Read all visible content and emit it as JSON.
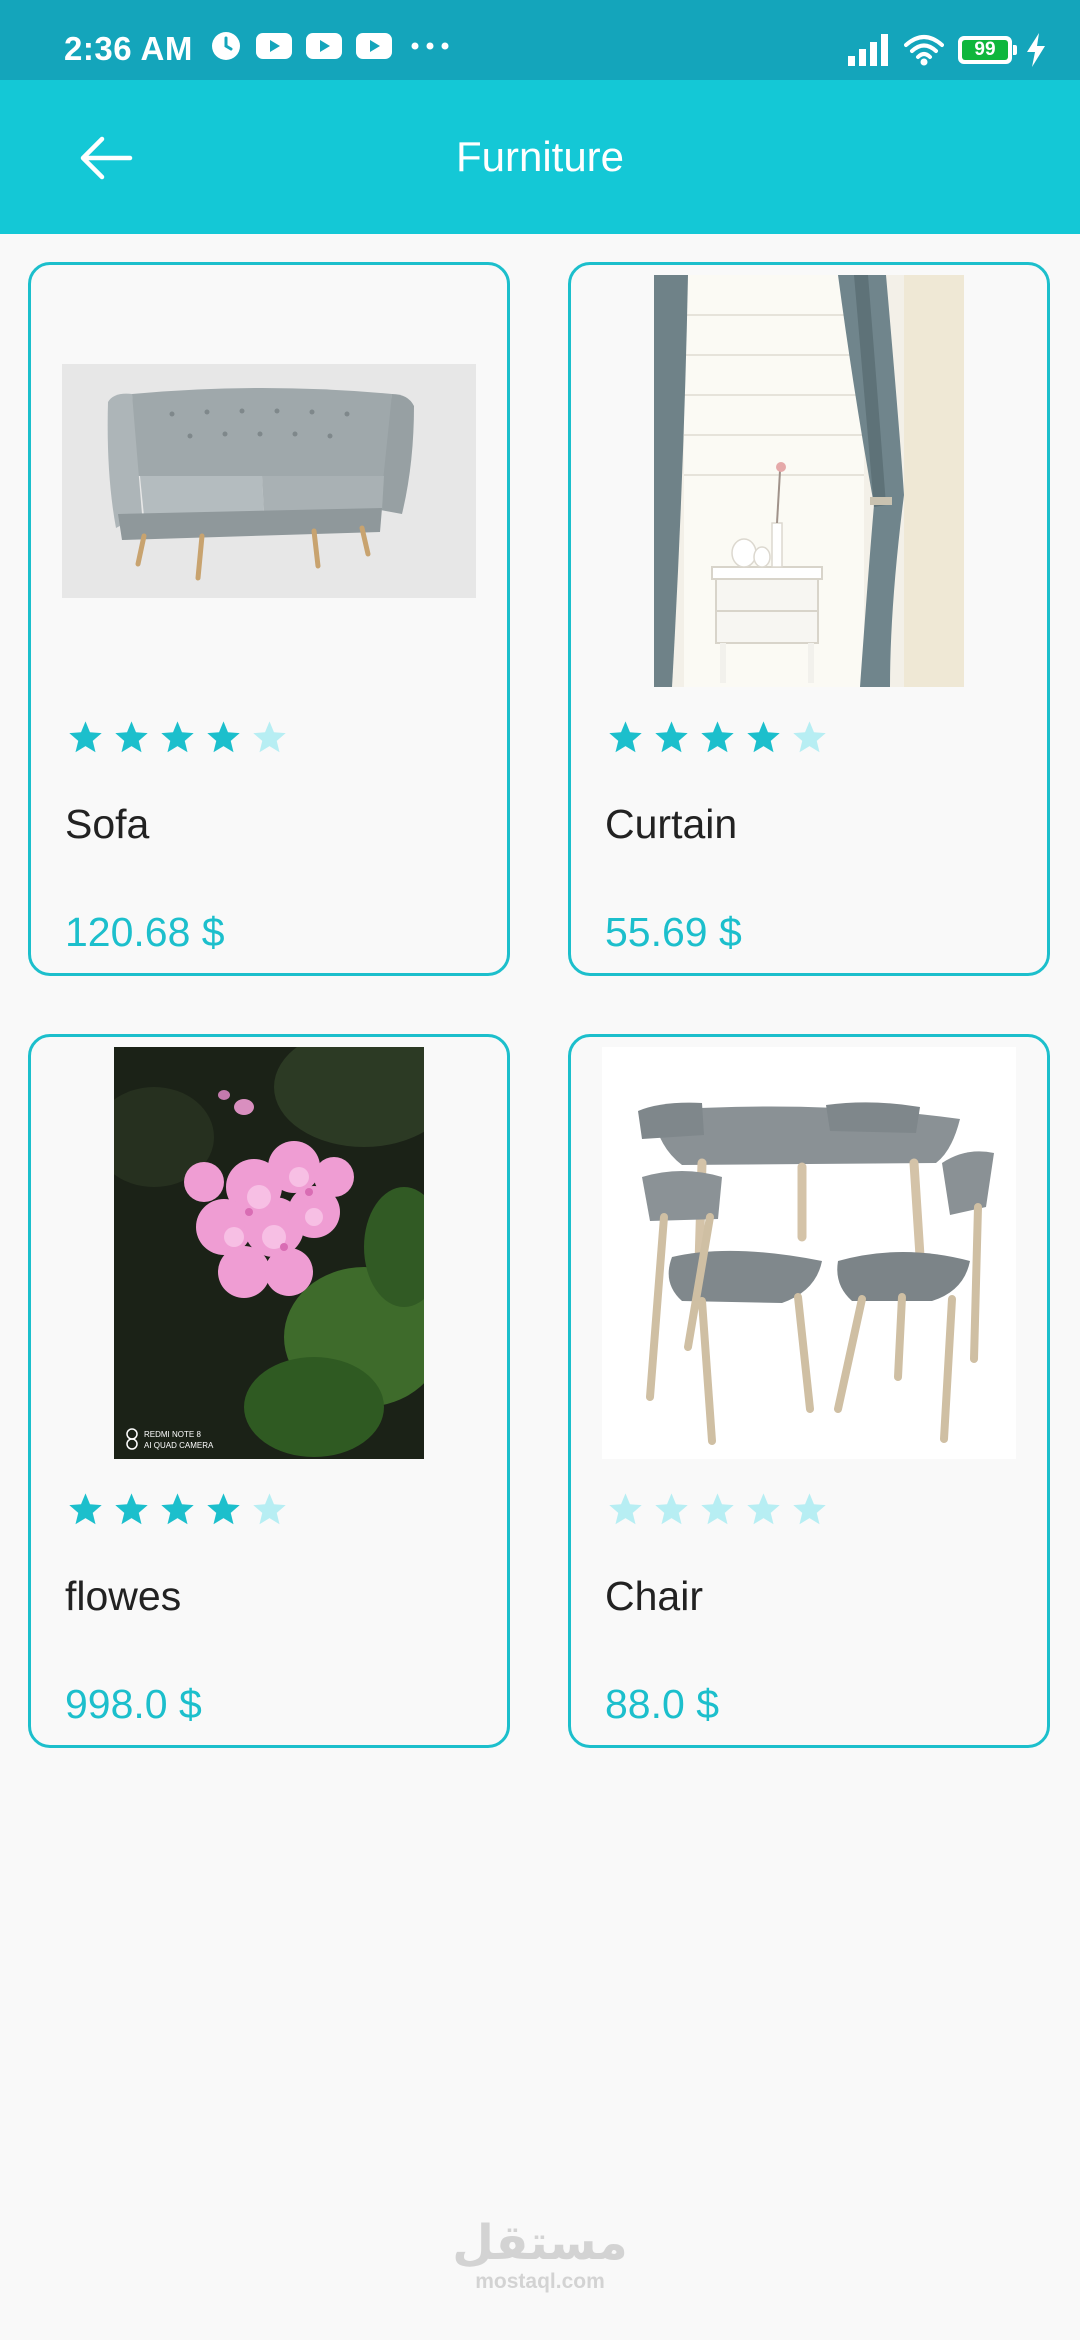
{
  "status_bar": {
    "time": "2:36 AM",
    "battery": "99",
    "left_icons": [
      "alarm-clock-icon",
      "youtube-icon",
      "youtube-icon",
      "youtube-icon",
      "more-dots-icon"
    ],
    "right_icons": [
      "signal-icon",
      "wifi-icon",
      "battery-icon",
      "charging-icon"
    ]
  },
  "app_bar": {
    "title": "Furniture",
    "back_icon": "arrow-left-icon"
  },
  "theme": {
    "accent": "#1cbfcc",
    "app_bar": "#14c8d6",
    "status_bar": "#14a5bb",
    "star_filled": "#1cbfcc",
    "star_empty": "#b7eef3"
  },
  "products": [
    {
      "name": "Sofa",
      "price": "120.68 $",
      "rating": 4,
      "max_rating": 5,
      "image": "sofa-image"
    },
    {
      "name": "Curtain",
      "price": "55.69 $",
      "rating": 4,
      "max_rating": 5,
      "image": "curtain-image"
    },
    {
      "name": "flowes",
      "price": "998.0 $",
      "rating": 4,
      "max_rating": 5,
      "image": "flower-image",
      "image_caption": "REDMI NOTE 8\nAI QUAD CAMERA"
    },
    {
      "name": "Chair",
      "price": "88.0 $",
      "rating": 0,
      "max_rating": 5,
      "image": "dining-set-image"
    }
  ],
  "watermark": {
    "arabic": "مستقل",
    "latin": "mostaql.com"
  }
}
